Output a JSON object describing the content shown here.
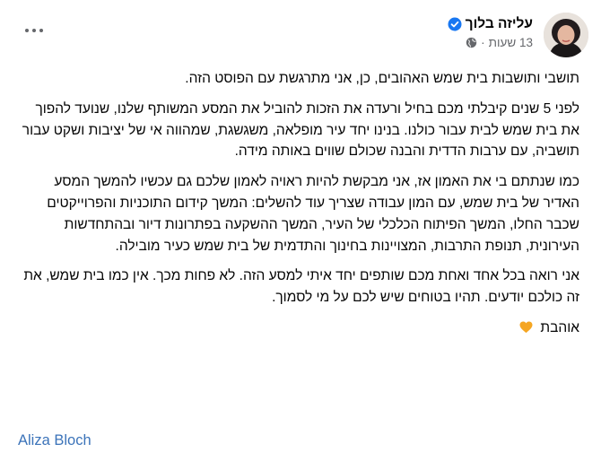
{
  "author": {
    "name": "עליזה בלוך",
    "time": "13 שעות"
  },
  "post": {
    "paragraphs": [
      "תושבי ותושבות בית שמש האהובים, כן, אני מתרגשת עם הפוסט הזה.",
      "לפני 5 שנים קיבלתי מכם בחיל ורעדה את הזכות להוביל את המסע המשותף שלנו, שנועד להפוך את בית שמש לבית עבור כולנו. בנינו יחד עיר מופלאה, משגשגת, שמהווה אי של יציבות ושקט עבור תושביה, עם ערבות הדדית והבנה שכולם שווים באותה מידה.",
      "כמו שנתתם בי את האמון אז, אני מבקשת להיות ראויה לאמון שלכם גם עכשיו להמשך המסע האדיר של בית שמש, עם המון עבודה שצריך עוד להשלים: המשך קידום התוכניות והפרוייקטים שכבר החלו, המשך הפיתוח הכלכלי של העיר, המשך ההשקעה בפתרונות דיור ובהתחדשות העירונית, תנופת התרבות, המצויינות בחינוך והתדמית של בית שמש כעיר מובילה.",
      "אני רואה בכל אחד ואחת מכם שותפים יחד איתי למסע הזה. לא פחות מכך. אין כמו בית שמש, את זה כולכם יודעים. תהיו בטוחים שיש לכם על מי לסמוך."
    ],
    "closing": "אוהבת"
  },
  "signature": "Aliza Bloch",
  "colors": {
    "text": "#050505",
    "meta": "#65676b",
    "verified": "#1877f2",
    "signature": "#3b73b9",
    "heart": "#f5a623"
  },
  "icons": [
    "verified-icon",
    "globe-icon",
    "more-options-icon",
    "orange-heart-icon"
  ]
}
